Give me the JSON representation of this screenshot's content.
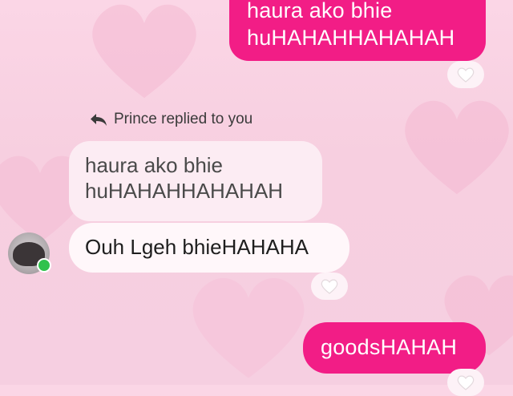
{
  "messages": {
    "outgoing_top": {
      "line1": "haura ako bhie",
      "line2": "huHAHAHHAHAHAH"
    },
    "reply_label": "Prince replied to you",
    "quoted": {
      "line1": "haura ako bhie",
      "line2": "huHAHAHHAHAHAH"
    },
    "incoming": "Ouh Lgeh bhieHAHAHA",
    "outgoing_bottom": "goodsHAHAH"
  },
  "colors": {
    "outgoing_bubble": "#f21d86",
    "background": "#f7cfe0",
    "online": "#31c24d"
  },
  "icons": {
    "reply": "reply-arrow-icon",
    "reaction": "white-heart-icon",
    "avatar": "user-avatar"
  }
}
